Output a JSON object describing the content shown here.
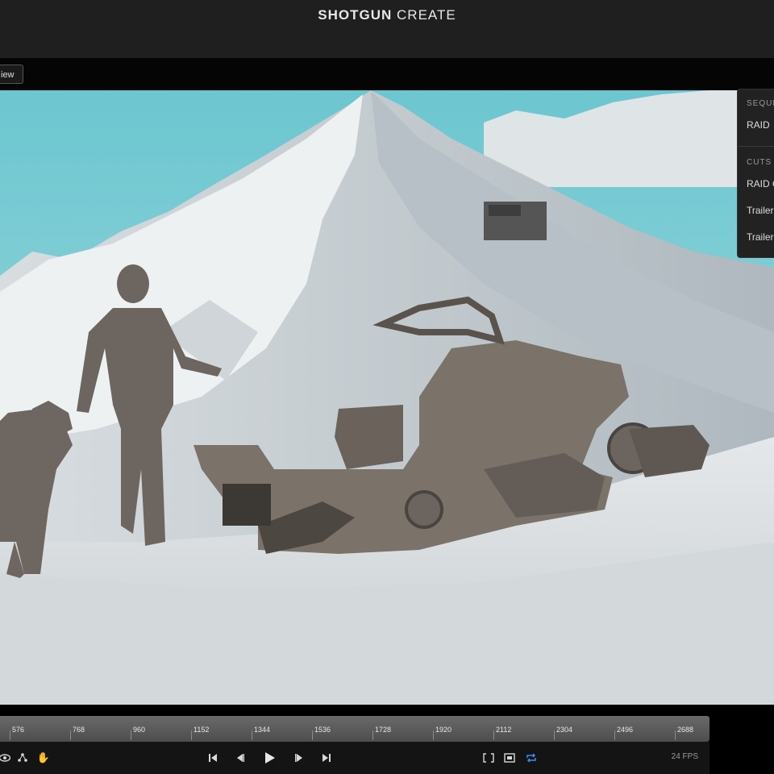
{
  "app": {
    "title_bold": "SHOTGUN",
    "title_light": "CREATE"
  },
  "toolbar": {
    "review_label": "iew"
  },
  "panel": {
    "sequences_header": "SEQUE",
    "sequence_item": "RAID",
    "cuts_header": "CUTS",
    "cut_items": [
      "RAID C",
      "Trailer",
      "Trailer"
    ]
  },
  "timeline": {
    "ticks": [
      "576",
      "768",
      "960",
      "1152",
      "1344",
      "1536",
      "1728",
      "1920",
      "2112",
      "2304",
      "2496",
      "2688"
    ]
  },
  "controls": {
    "fps": "24 FPS",
    "icons": [
      "eye-icon",
      "nodes-icon",
      "hand-icon",
      "skip-start-icon",
      "step-back-icon",
      "play-icon",
      "step-forward-icon",
      "skip-end-icon",
      "brackets-icon",
      "screen-icon",
      "loop-icon"
    ],
    "accent": "#3a8ef0"
  }
}
